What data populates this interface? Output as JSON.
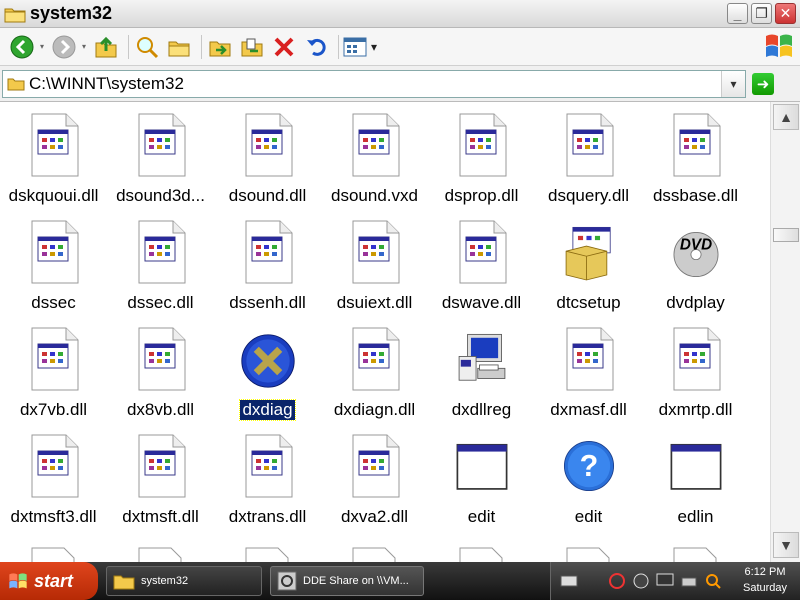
{
  "window": {
    "title": "system32"
  },
  "toolbar": {
    "back_arrow": "▾",
    "forward_arrow": "▾",
    "views_arrow": "▾"
  },
  "address": {
    "path": "C:\\WINNT\\system32",
    "dropdown": "▾",
    "go": "➜"
  },
  "files": [
    {
      "name": "dskquoui.dll",
      "icon": "dll-icon"
    },
    {
      "name": "dsound3d...",
      "icon": "dll-icon"
    },
    {
      "name": "dsound.dll",
      "icon": "dll-icon"
    },
    {
      "name": "dsound.vxd",
      "icon": "dll-icon"
    },
    {
      "name": "dsprop.dll",
      "icon": "dll-icon"
    },
    {
      "name": "dsquery.dll",
      "icon": "dll-icon"
    },
    {
      "name": "dssbase.dll",
      "icon": "dll-icon"
    },
    {
      "name": "dssec",
      "icon": "dll-icon"
    },
    {
      "name": "dssec.dll",
      "icon": "dll-icon"
    },
    {
      "name": "dssenh.dll",
      "icon": "dll-icon"
    },
    {
      "name": "dsuiext.dll",
      "icon": "dll-icon"
    },
    {
      "name": "dswave.dll",
      "icon": "dll-icon"
    },
    {
      "name": "dtcsetup",
      "icon": "setup-box-icon"
    },
    {
      "name": "dvdplay",
      "icon": "dvd-icon"
    },
    {
      "name": "dx7vb.dll",
      "icon": "dll-icon"
    },
    {
      "name": "dx8vb.dll",
      "icon": "dll-icon"
    },
    {
      "name": "dxdiag",
      "icon": "directx-icon",
      "selected": true
    },
    {
      "name": "dxdiagn.dll",
      "icon": "dll-icon"
    },
    {
      "name": "dxdllreg",
      "icon": "computer-setup-icon"
    },
    {
      "name": "dxmasf.dll",
      "icon": "dll-icon"
    },
    {
      "name": "dxmrtp.dll",
      "icon": "dll-icon"
    },
    {
      "name": "dxtmsft3.dll",
      "icon": "dll-icon"
    },
    {
      "name": "dxtmsft.dll",
      "icon": "dll-icon"
    },
    {
      "name": "dxtrans.dll",
      "icon": "dll-icon"
    },
    {
      "name": "dxva2.dll",
      "icon": "dll-icon"
    },
    {
      "name": "edit",
      "icon": "window-app-icon"
    },
    {
      "name": "edit",
      "icon": "help-icon"
    },
    {
      "name": "edlin",
      "icon": "window-app-icon"
    }
  ],
  "taskbar": {
    "start_label": "start",
    "tasks": [
      {
        "label": "system32",
        "active": true
      },
      {
        "label": "DDE Share on \\\\VM...",
        "active": false
      }
    ],
    "clock_time": "6:12 PM",
    "clock_day": "Saturday"
  },
  "colors": {
    "selection": "#0a246a",
    "start_button": "#d0401a"
  }
}
